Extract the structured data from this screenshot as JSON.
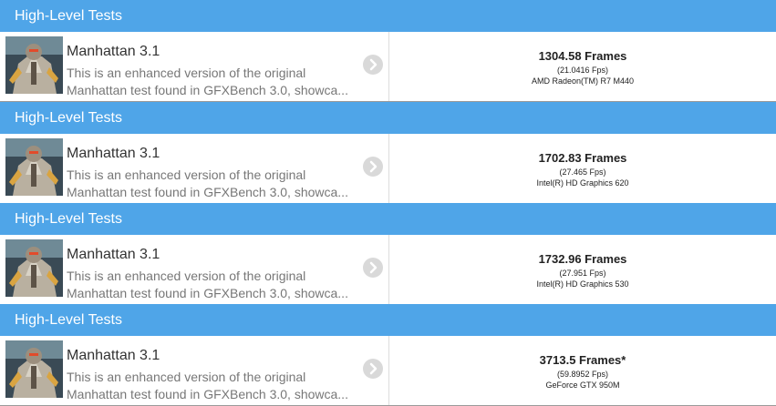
{
  "results": [
    {
      "section_header": "High-Level Tests",
      "test_name": "Manhattan 3.1",
      "description_line1": "This is an enhanced version of the original",
      "description_line2": "Manhattan test found in GFXBench 3.0, showca...",
      "frames": "1304.58 Frames",
      "fps": "(21.0416 Fps)",
      "device": "AMD Radeon(TM) R7 M440"
    },
    {
      "section_header": "High-Level Tests",
      "test_name": "Manhattan 3.1",
      "description_line1": "This is an enhanced version of the original",
      "description_line2": "Manhattan test found in GFXBench 3.0, showca...",
      "frames": "1702.83 Frames",
      "fps": "(27.465 Fps)",
      "device": "Intel(R) HD Graphics 620"
    },
    {
      "section_header": "High-Level Tests",
      "test_name": "Manhattan 3.1",
      "description_line1": "This is an enhanced version of the original",
      "description_line2": "Manhattan test found in GFXBench 3.0, showca...",
      "frames": "1732.96 Frames",
      "fps": "(27.951 Fps)",
      "device": "Intel(R) HD Graphics 530"
    },
    {
      "section_header": "High-Level Tests",
      "test_name": "Manhattan 3.1",
      "description_line1": "This is an enhanced version of the original",
      "description_line2": "Manhattan test found in GFXBench 3.0, showca...",
      "frames": "3713.5 Frames*",
      "fps": "(59.8952 Fps)",
      "device": "GeForce GTX 950M"
    }
  ],
  "colors": {
    "header_bg": "#4fa5e8",
    "header_text": "#ffffff",
    "chevron_bg": "#d9d9d9"
  },
  "icons": {
    "thumbnail": "manhattan-robot-thumbnail",
    "chevron": "chevron-right-icon"
  }
}
